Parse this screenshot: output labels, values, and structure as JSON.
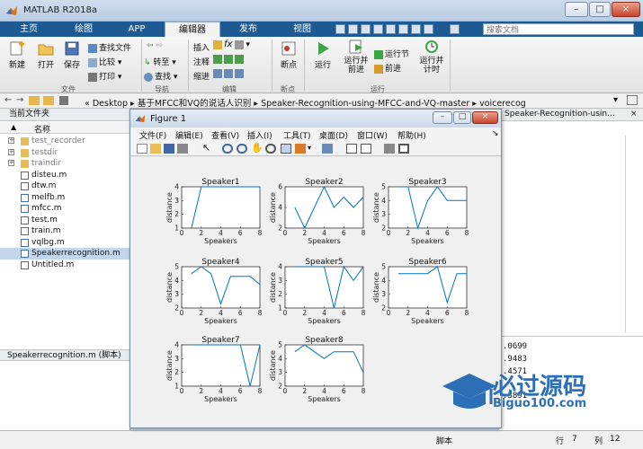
{
  "window": {
    "title": "MATLAB R2018a",
    "controls": [
      "–",
      "□",
      "×"
    ]
  },
  "tabs": [
    {
      "label": "主页",
      "active": false
    },
    {
      "label": "绘图",
      "active": false
    },
    {
      "label": "APP",
      "active": false
    },
    {
      "label": "编辑器",
      "active": true
    },
    {
      "label": "发布",
      "active": false
    },
    {
      "label": "视图",
      "active": false
    }
  ],
  "search": {
    "placeholder": "搜索文档"
  },
  "ribbon": {
    "file_group": {
      "label": "文件",
      "new": "新建",
      "open": "打开",
      "save": "保存",
      "find_files": "查找文件",
      "compare": "比较",
      "print": "打印"
    },
    "nav_group": {
      "label": "导航",
      "goto": "转至",
      "find": "查找"
    },
    "edit_group": {
      "label": "编辑",
      "insert": "插入",
      "comment": "注释",
      "indent": "缩进",
      "fx": "fx"
    },
    "breakpoints_group": {
      "label": "断点",
      "breakpoints": "断点"
    },
    "run_group": {
      "label": "运行",
      "run": "运行",
      "run_advance": "运行并\n前进",
      "run_section": "运行节",
      "advance": "前进",
      "run_time": "运行并\n计时"
    }
  },
  "address": {
    "segments": [
      "«",
      "Desktop",
      "基于MFCC和VQ的说话人识别",
      "Speaker-Recognition-using-MFCC-and-VQ-master",
      "voicerecog"
    ]
  },
  "current_folder": {
    "title": "当前文件夹",
    "column_name": "名称",
    "files": [
      {
        "name": "test_recorder",
        "type": "folder",
        "selected": false
      },
      {
        "name": "testdir",
        "type": "folder",
        "selected": false
      },
      {
        "name": "traindir",
        "type": "folder",
        "selected": false
      },
      {
        "name": "disteu.m",
        "type": "m",
        "selected": false
      },
      {
        "name": "dtw.m",
        "type": "m",
        "selected": false
      },
      {
        "name": "melfb.m",
        "type": "m",
        "selected": false
      },
      {
        "name": "mfcc.m",
        "type": "m",
        "selected": false
      },
      {
        "name": "test.m",
        "type": "m",
        "selected": false
      },
      {
        "name": "train.m",
        "type": "m",
        "selected": false
      },
      {
        "name": "vqlbg.m",
        "type": "m",
        "selected": false
      },
      {
        "name": "Speakerrecognition.m",
        "type": "m",
        "selected": true
      },
      {
        "name": "Untitled.m",
        "type": "m",
        "selected": false
      }
    ],
    "details": "Speakerrecognition.m (脚本)"
  },
  "editor_tab": {
    "label": "Speaker-Recognition-usin..."
  },
  "workspace_values": [
    ".0699",
    ".9483",
    ".4571",
    ".3891"
  ],
  "status": {
    "mode": "脚本",
    "row_label": "行",
    "row": "7",
    "col_label": "列",
    "col": "12"
  },
  "figure": {
    "title": "Figure 1",
    "menus": [
      "文件(F)",
      "编辑(E)",
      "查看(V)",
      "插入(I)",
      "工具(T)",
      "桌面(D)",
      "窗口(W)",
      "帮助(H)"
    ]
  },
  "chart_data": [
    {
      "type": "line",
      "title": "Speaker1",
      "xlabel": "Speakers",
      "ylabel": "distance",
      "xlim": [
        0,
        8
      ],
      "ylim": [
        1,
        4
      ],
      "xticks": [
        0,
        2,
        4,
        6,
        8
      ],
      "yticks": [
        1,
        2,
        3,
        4
      ],
      "x": [
        1,
        2,
        3,
        4,
        5,
        6,
        7,
        8
      ],
      "y": [
        1,
        4,
        4,
        4,
        4,
        4,
        4,
        4
      ]
    },
    {
      "type": "line",
      "title": "Speaker2",
      "xlabel": "Speakers",
      "ylabel": "distance",
      "xlim": [
        0,
        8
      ],
      "ylim": [
        2,
        6
      ],
      "xticks": [
        0,
        2,
        4,
        6,
        8
      ],
      "yticks": [
        2,
        4,
        6
      ],
      "x": [
        1,
        2,
        3,
        4,
        5,
        6,
        7,
        8
      ],
      "y": [
        4,
        2,
        4,
        6,
        4,
        5,
        4,
        5
      ]
    },
    {
      "type": "line",
      "title": "Speaker3",
      "xlabel": "Speakers",
      "ylabel": "distance",
      "xlim": [
        0,
        8
      ],
      "ylim": [
        2,
        5
      ],
      "xticks": [
        0,
        2,
        4,
        6,
        8
      ],
      "yticks": [
        2,
        3,
        4,
        5
      ],
      "x": [
        1,
        2,
        3,
        4,
        5,
        6,
        7,
        8
      ],
      "y": [
        5,
        5,
        2,
        4,
        5,
        4,
        4,
        4
      ]
    },
    {
      "type": "line",
      "title": "Speaker4",
      "xlabel": "Speakers",
      "ylabel": "distance",
      "xlim": [
        0,
        8
      ],
      "ylim": [
        2,
        5
      ],
      "xticks": [
        0,
        2,
        4,
        6,
        8
      ],
      "yticks": [
        2,
        3,
        4,
        5
      ],
      "x": [
        1,
        2,
        3,
        4,
        5,
        6,
        7,
        8
      ],
      "y": [
        4.5,
        5,
        4.5,
        2.3,
        4.3,
        4.3,
        4.3,
        3.7
      ]
    },
    {
      "type": "line",
      "title": "Speaker5",
      "xlabel": "Speakers",
      "ylabel": "distance",
      "xlim": [
        0,
        8
      ],
      "ylim": [
        1,
        4
      ],
      "xticks": [
        0,
        2,
        4,
        6,
        8
      ],
      "yticks": [
        1,
        2,
        3,
        4
      ],
      "x": [
        1,
        2,
        3,
        4,
        5,
        6,
        7,
        8
      ],
      "y": [
        4,
        4,
        4,
        4,
        1,
        4,
        3,
        4
      ]
    },
    {
      "type": "line",
      "title": "Speaker6",
      "xlabel": "Speakers",
      "ylabel": "distance",
      "xlim": [
        0,
        8
      ],
      "ylim": [
        2,
        5
      ],
      "xticks": [
        0,
        2,
        4,
        6,
        8
      ],
      "yticks": [
        2,
        3,
        4,
        5
      ],
      "x": [
        1,
        2,
        3,
        4,
        5,
        6,
        7,
        8
      ],
      "y": [
        4.5,
        4.5,
        4.5,
        4.5,
        5,
        2.4,
        4.5,
        4.5
      ]
    },
    {
      "type": "line",
      "title": "Speaker7",
      "xlabel": "Speakers",
      "ylabel": "distance",
      "xlim": [
        0,
        8
      ],
      "ylim": [
        1,
        4
      ],
      "xticks": [
        0,
        2,
        4,
        6,
        8
      ],
      "yticks": [
        1,
        2,
        3,
        4
      ],
      "x": [
        1,
        2,
        3,
        4,
        5,
        6,
        7,
        8
      ],
      "y": [
        4,
        4,
        4,
        4,
        4,
        4,
        1,
        4
      ]
    },
    {
      "type": "line",
      "title": "Speaker8",
      "xlabel": "Speakers",
      "ylabel": "distance",
      "xlim": [
        0,
        8
      ],
      "ylim": [
        2,
        5
      ],
      "xticks": [
        0,
        2,
        4,
        6,
        8
      ],
      "yticks": [
        2,
        3,
        4,
        5
      ],
      "x": [
        1,
        2,
        3,
        4,
        5,
        6,
        7,
        8
      ],
      "y": [
        4.5,
        5,
        4.5,
        4,
        4.5,
        4.5,
        4.5,
        3
      ]
    }
  ],
  "watermark": {
    "brand": "必过源码",
    "url": "Biguo100.com"
  },
  "colors": {
    "line": "#0072bd",
    "tabbar": "#1d5a93",
    "selection": "#c2d6ec"
  }
}
